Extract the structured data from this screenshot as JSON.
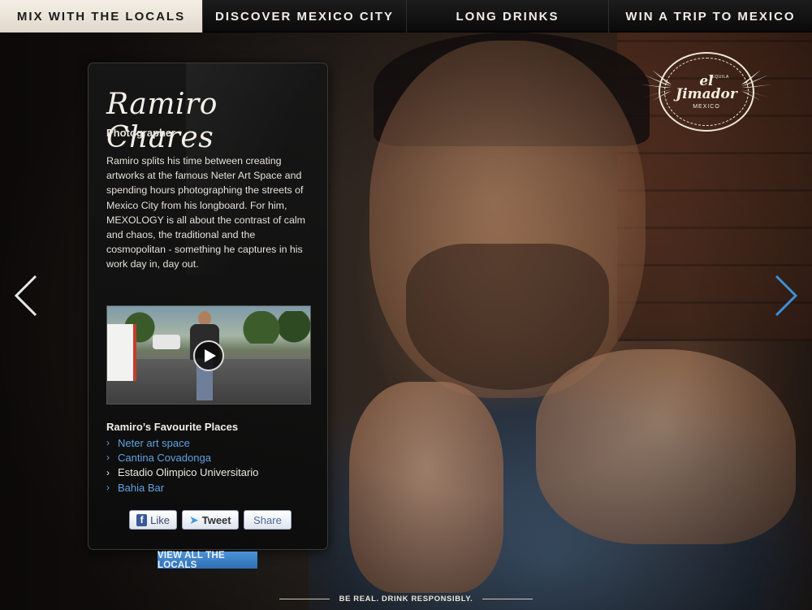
{
  "nav": {
    "tabs": [
      {
        "label": "MIX WITH THE LOCALS",
        "active": true
      },
      {
        "label": "DISCOVER MEXICO CITY",
        "active": false
      },
      {
        "label": "LONG DRINKS",
        "active": false
      },
      {
        "label": "WIN A TRIP TO MEXICO",
        "active": false
      }
    ]
  },
  "profile": {
    "name": "Ramiro Chares",
    "role": "Photographer",
    "bio": "Ramiro splits his time between creating artworks at the famous Neter Art Space and spending hours photographing the streets of Mexico City from his longboard. For him, MEXOLOGY is all about the contrast of calm and chaos, the traditional and the cosmopolitan - something he captures in his work day in, day out.",
    "favourites_title": "Ramiro’s Favourite Places",
    "favourites": [
      {
        "label": "Neter art space",
        "link": true
      },
      {
        "label": "Cantina Covadonga",
        "link": true
      },
      {
        "label": "Estadio Olimpico Universitario",
        "link": false
      },
      {
        "label": "Bahia Bar",
        "link": true
      }
    ]
  },
  "share": {
    "like_label": "Like",
    "like_icon": "f",
    "tweet_label": "Tweet",
    "share_label": "Share"
  },
  "view_all_label": "VIEW ALL THE LOCALS",
  "logo": {
    "brand_line1": "el",
    "brand_line2": "Jimador",
    "tag": "TEQUILA",
    "sub": "MEXICO"
  },
  "footer": {
    "text": "BE REAL. DRINK RESPONSIBLY."
  },
  "colors": {
    "link_blue": "#5ea3e0",
    "button_blue": "#3a82c8",
    "active_tab_bg": "#efe9df"
  }
}
